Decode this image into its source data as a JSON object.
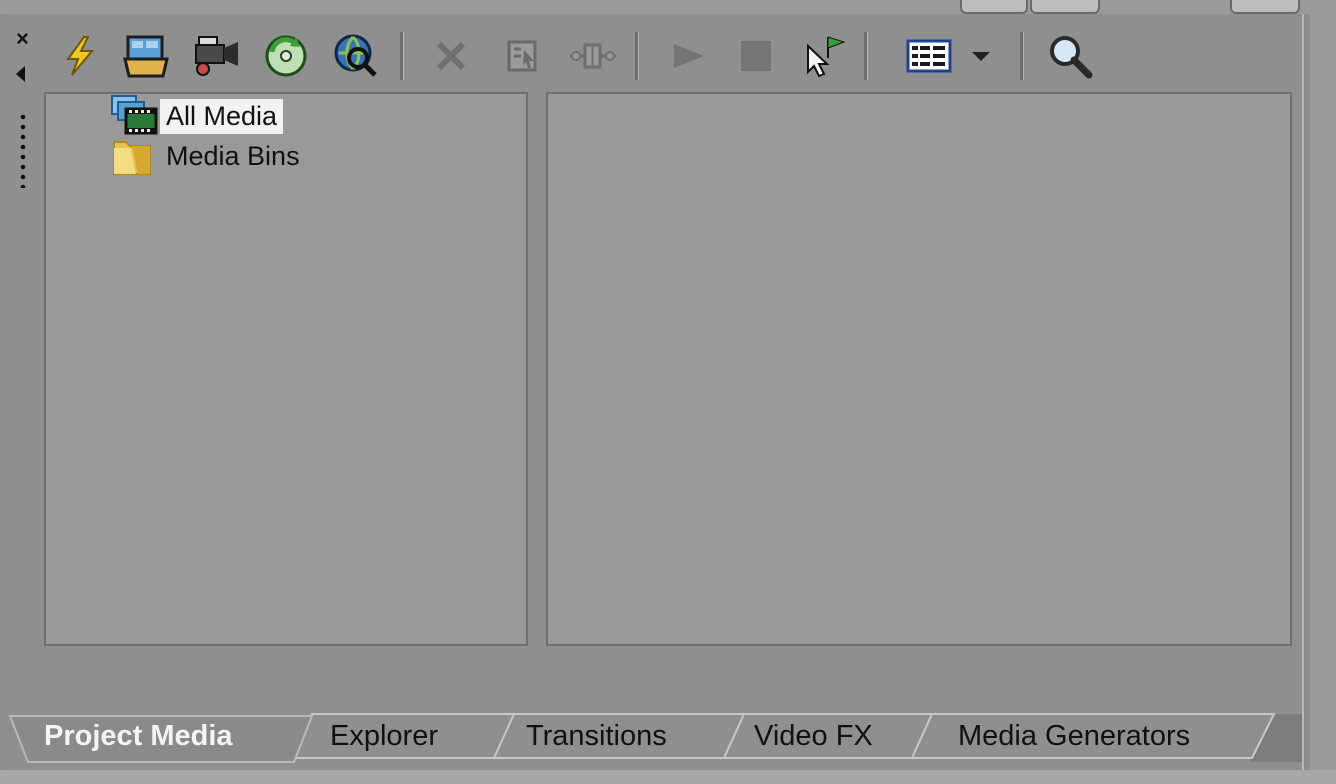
{
  "toolbar": {
    "buttons": [
      {
        "icon": "lightning-icon"
      },
      {
        "icon": "import-media-icon"
      },
      {
        "icon": "capture-video-icon"
      },
      {
        "icon": "get-media-from-cd-icon"
      },
      {
        "icon": "get-media-from-web-icon"
      },
      {
        "icon": "remove-icon"
      },
      {
        "icon": "media-fx-icon"
      },
      {
        "icon": "media-properties-icon"
      },
      {
        "icon": "play-icon"
      },
      {
        "icon": "stop-icon"
      },
      {
        "icon": "auto-preview-icon"
      },
      {
        "icon": "views-icon"
      },
      {
        "icon": "views-dropdown-icon"
      },
      {
        "icon": "search-icon"
      }
    ]
  },
  "tree": {
    "items": [
      {
        "label": "All Media",
        "icon": "all-media-icon",
        "selected": true
      },
      {
        "label": "Media Bins",
        "icon": "folder-icon",
        "selected": false
      }
    ]
  },
  "tabs": [
    {
      "label": "Project Media",
      "active": true
    },
    {
      "label": "Explorer",
      "active": false
    },
    {
      "label": "Transitions",
      "active": false
    },
    {
      "label": "Video FX",
      "active": false
    },
    {
      "label": "Media Generators",
      "active": false
    }
  ],
  "colors": {
    "panel_bg": "#8f8f8f",
    "pane_bg": "#999999",
    "tab_active_text": "#f4f4f4",
    "selection_bg": "#f2f2f2"
  }
}
